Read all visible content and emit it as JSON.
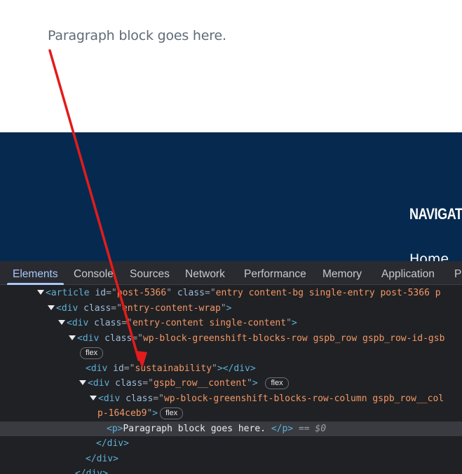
{
  "page": {
    "paragraph": "Paragraph block goes here.",
    "nav_heading": "NAVIGAT",
    "nav_link": "Home"
  },
  "devtools": {
    "tabs": [
      "Elements",
      "Console",
      "Sources",
      "Network",
      "Performance",
      "Memory",
      "Application",
      "Pr"
    ],
    "active_tab": "Elements",
    "tree": {
      "article": {
        "id_attr": "id",
        "id_val": "post-5366",
        "class_attr": "class",
        "class_val": "entry content-bg single-entry post-5366 p"
      },
      "wrap": {
        "class_val": "entry-content-wrap"
      },
      "content": {
        "class_val": "entry-content single-content"
      },
      "row": {
        "class_val": "wp-block-greenshift-blocks-row gspb_row gspb_row-id-gsb"
      },
      "flex_badge": "flex",
      "sustain": {
        "id_val": "sustainability"
      },
      "row_content": {
        "class_val": "gspb_row__content"
      },
      "column": {
        "class_val_1": "wp-block-greenshift-blocks-row-column gspb_row__col",
        "class_val_2": "p-164ceb9"
      },
      "p": {
        "text": "Paragraph block goes here. ",
        "ref": "== $0"
      }
    }
  },
  "colors": {
    "footer_bg": "#062a4f",
    "arrow": "#e31b1b",
    "active_tab": "#a8c7fa"
  }
}
